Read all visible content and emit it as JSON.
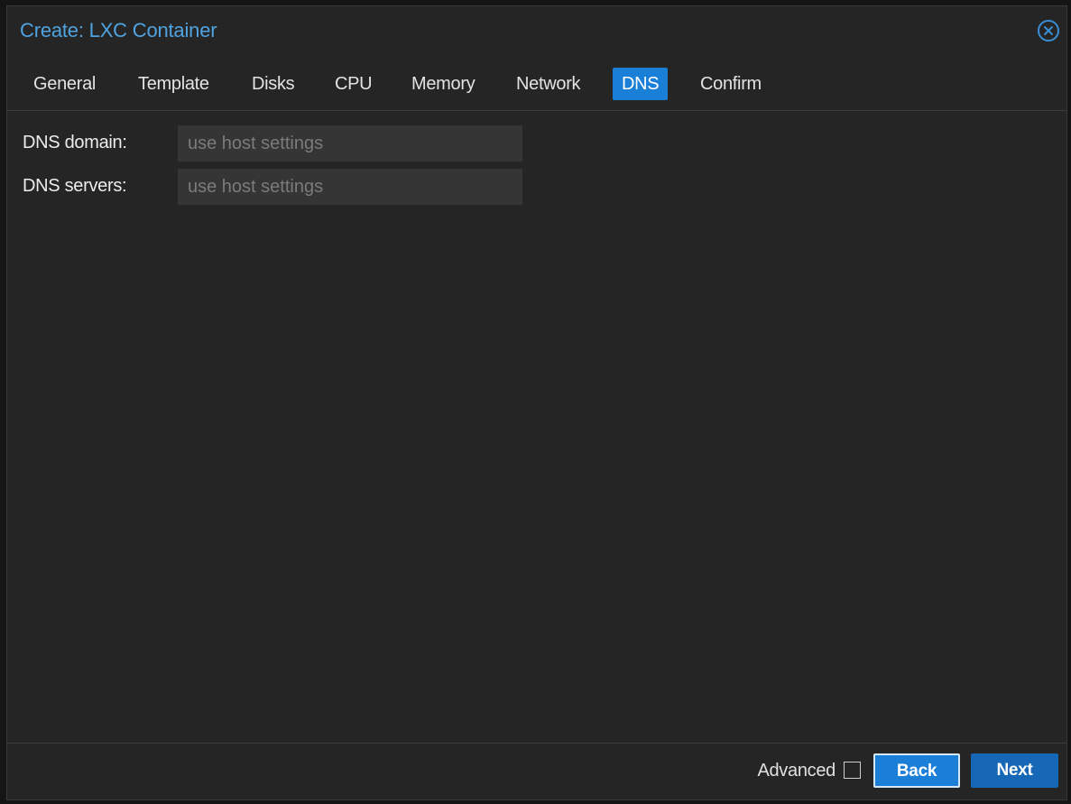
{
  "dialog": {
    "title": "Create: LXC Container",
    "close_icon": "close-circle-icon"
  },
  "tabs": [
    {
      "label": "General",
      "active": false
    },
    {
      "label": "Template",
      "active": false
    },
    {
      "label": "Disks",
      "active": false
    },
    {
      "label": "CPU",
      "active": false
    },
    {
      "label": "Memory",
      "active": false
    },
    {
      "label": "Network",
      "active": false
    },
    {
      "label": "DNS",
      "active": true
    },
    {
      "label": "Confirm",
      "active": false
    }
  ],
  "form": {
    "dns_domain": {
      "label": "DNS domain:",
      "value": "",
      "placeholder": "use host settings"
    },
    "dns_servers": {
      "label": "DNS servers:",
      "value": "",
      "placeholder": "use host settings"
    }
  },
  "footer": {
    "advanced_label": "Advanced",
    "advanced_checked": false,
    "back_label": "Back",
    "next_label": "Next"
  },
  "colors": {
    "accent": "#1a7fd6",
    "title": "#4fa3e0",
    "background": "#252525"
  }
}
